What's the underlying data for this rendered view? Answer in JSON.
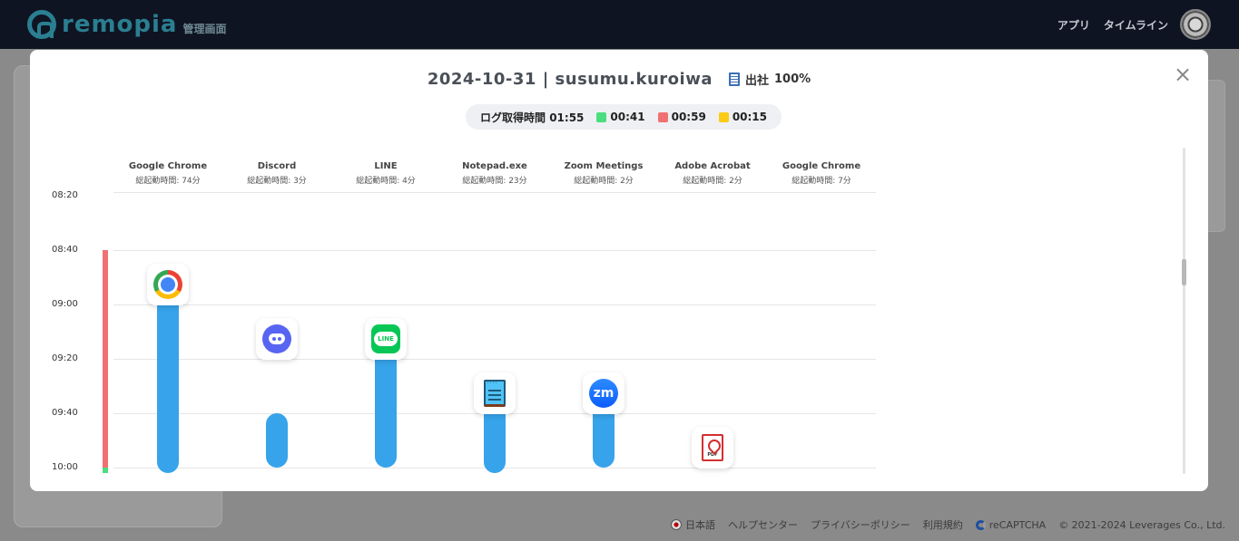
{
  "app": {
    "logo_text": "remopia",
    "logo_sub": "管理画面",
    "nav": [
      "アプリ",
      "タイムライン"
    ]
  },
  "modal": {
    "title": "2024-10-31 | susumu.kuroiwa",
    "attendance_label": "出社",
    "attendance_value": "100%",
    "close_symbol": "×",
    "summary": {
      "log_label": "ログ取得時間",
      "log_total": "01:55",
      "legend": [
        {
          "color": "#4ade80",
          "value": "00:41"
        },
        {
          "color": "#f07171",
          "value": "00:59"
        },
        {
          "color": "#facc15",
          "value": "00:15"
        }
      ]
    }
  },
  "chart_data": {
    "type": "bar",
    "y_ticks": [
      "08:20",
      "08:40",
      "09:00",
      "09:20",
      "09:40",
      "10:00"
    ],
    "columns": [
      {
        "name": "Google Chrome",
        "total": "総起動時間: 74分",
        "icon": "chrome-icon",
        "segments": [
          {
            "start": "08:48",
            "end": "10:02"
          }
        ]
      },
      {
        "name": "Discord",
        "total": "総起動時間: 3分",
        "icon": "discord-icon",
        "segments": [
          {
            "start": "09:08",
            "end": "09:20"
          },
          {
            "start": "09:40",
            "end": "10:00"
          }
        ]
      },
      {
        "name": "LINE",
        "total": "総起動時間: 4分",
        "icon": "line-icon",
        "segments": [
          {
            "start": "09:08",
            "end": "10:00"
          }
        ]
      },
      {
        "name": "Notepad.exe",
        "total": "総起動時間: 23分",
        "icon": "notepad-icon",
        "segments": [
          {
            "start": "09:28",
            "end": "10:02"
          }
        ]
      },
      {
        "name": "Zoom Meetings",
        "total": "総起動時間: 2分",
        "icon": "zoom-icon",
        "segments": [
          {
            "start": "09:28",
            "end": "10:00"
          }
        ]
      },
      {
        "name": "Adobe Acrobat",
        "total": "総起動時間: 2分",
        "icon": "acrobat-icon",
        "segments": [
          {
            "start": "09:48",
            "end": "10:00"
          }
        ]
      },
      {
        "name": "Google Chrome",
        "total": "総起動時間: 7分",
        "icon": "chrome-icon",
        "segments": []
      }
    ],
    "status_strip": [
      {
        "color": "#f07171",
        "start": "08:40",
        "end": "10:00"
      },
      {
        "color": "#4ade80",
        "start": "10:00",
        "end": "10:02"
      }
    ]
  },
  "footer": {
    "lang": "日本語",
    "links": [
      "ヘルプセンター",
      "プライバシーポリシー",
      "利用規約"
    ],
    "recaptcha": "reCAPTCHA",
    "copyright": "© 2021-2024 Leverages Co., Ltd."
  }
}
